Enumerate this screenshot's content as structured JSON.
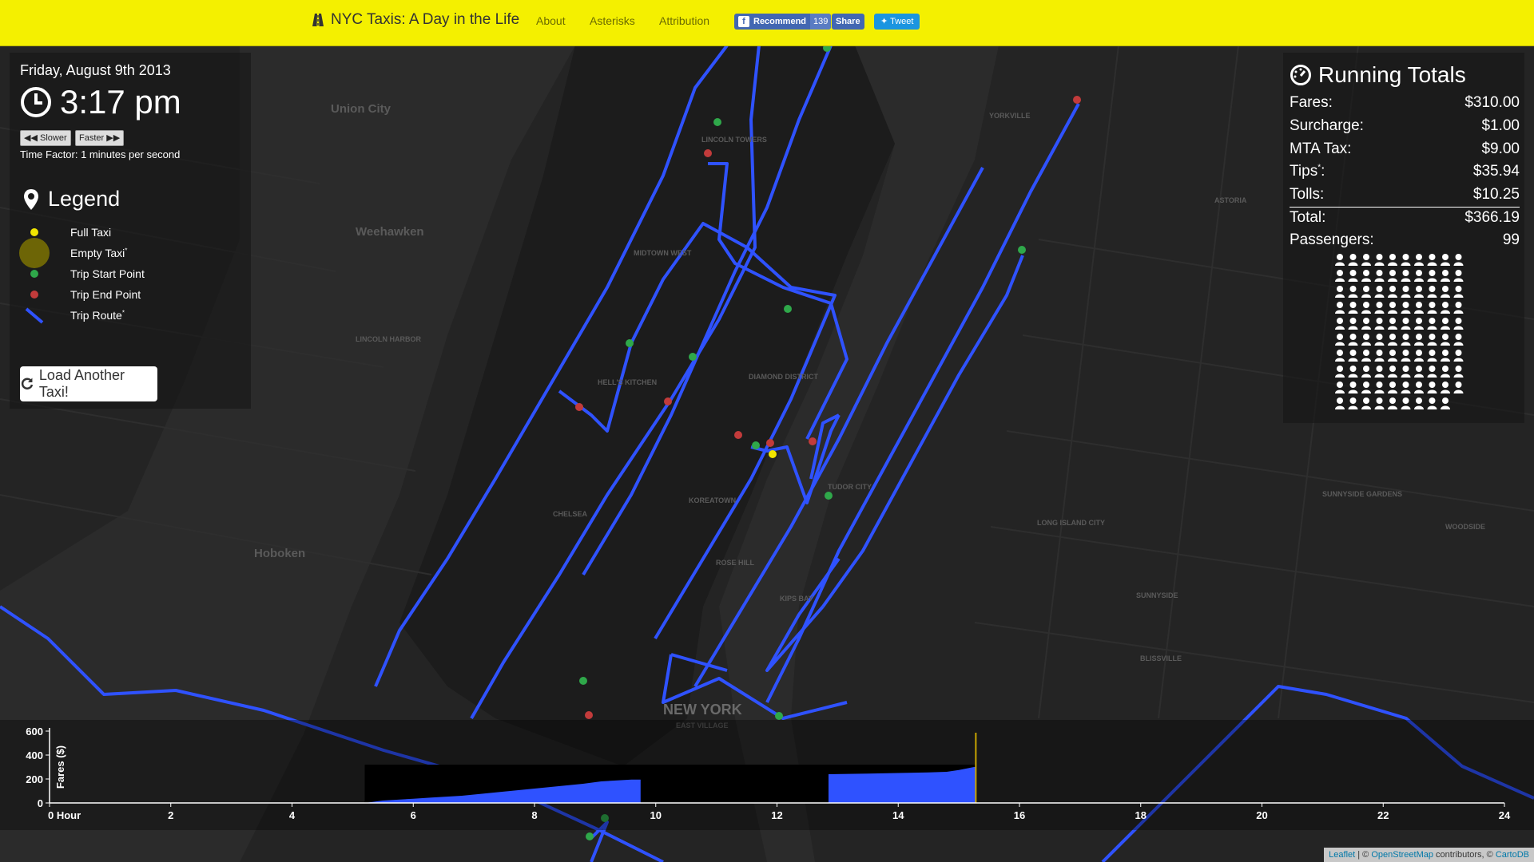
{
  "navbar": {
    "brand": "NYC Taxis: A Day in the Life",
    "links": [
      "About",
      "Asterisks",
      "Attribution"
    ],
    "fb_recommend": "Recommend",
    "fb_count": "139",
    "fb_share": "Share",
    "tweet": "Tweet"
  },
  "status": {
    "date": "Friday, August 9th 2013",
    "time": "3:17 pm",
    "slower": "Slower",
    "faster": "Faster",
    "time_factor": "Time Factor: 1 minutes per second"
  },
  "legend": {
    "title": "Legend",
    "items": [
      {
        "label": "Full Taxi",
        "color": "#f2e600"
      },
      {
        "label": "Empty Taxi",
        "color": "#8a7f00",
        "sup": "*"
      },
      {
        "label": "Trip Start Point",
        "color": "#2fa84a"
      },
      {
        "label": "Trip End Point",
        "color": "#c23b3b"
      },
      {
        "label": "Trip Route",
        "color": "#2f52ff",
        "sup": "*"
      }
    ]
  },
  "load_button": "Load Another Taxi!",
  "totals": {
    "title": "Running Totals",
    "fares_label": "Fares:",
    "fares": "$310.00",
    "surcharge_label": "Surcharge:",
    "surcharge": "$1.00",
    "mta_label": "MTA Tax:",
    "mta": "$9.00",
    "tips_label": "Tips",
    "tips_sup": "*",
    "tips_colon": ":",
    "tips": "$35.94",
    "tolls_label": "Tolls:",
    "tolls": "$10.25",
    "total_label": "Total:",
    "total": "$366.19",
    "passengers_label": "Passengers:",
    "passengers": "99"
  },
  "map_labels": [
    {
      "text": "Union City"
    },
    {
      "text": "Weehawken"
    },
    {
      "text": "Hoboken"
    },
    {
      "text": "NEW YORK"
    },
    {
      "text": "HELL'S KITCHEN"
    },
    {
      "text": "MIDTOWN WEST"
    },
    {
      "text": "DIAMOND DISTRICT"
    },
    {
      "text": "KOREATOWN"
    },
    {
      "text": "CHELSEA"
    },
    {
      "text": "ROSE HILL"
    },
    {
      "text": "KIPS BAY"
    },
    {
      "text": "TUDOR CITY"
    },
    {
      "text": "YORKVILLE"
    },
    {
      "text": "ASTORIA"
    },
    {
      "text": "LONG ISLAND CITY"
    },
    {
      "text": "SUNNYSIDE"
    },
    {
      "text": "WOODSIDE"
    },
    {
      "text": "BLISSVILLE"
    },
    {
      "text": "SUNNYSIDE GARDENS"
    },
    {
      "text": "LINCOLN HARBOR"
    },
    {
      "text": "LINCOLN TOWERS"
    },
    {
      "text": "EAST VILLAGE"
    }
  ],
  "chart_data": {
    "type": "area",
    "ylabel": "Fares ($)",
    "xlabel": "",
    "x_tick_labels": [
      "0 Hour",
      "2",
      "4",
      "6",
      "8",
      "10",
      "12",
      "14",
      "16",
      "18",
      "20",
      "22",
      "24"
    ],
    "y_ticks": [
      0,
      200,
      400,
      600
    ],
    "xlim": [
      0,
      24
    ],
    "ylim": [
      0,
      600
    ],
    "color": "#2f52ff",
    "current_hour": 15.28,
    "series": [
      {
        "values": [
          [
            5.2,
            0
          ],
          [
            5.5,
            20
          ],
          [
            6.0,
            35
          ],
          [
            6.3,
            45
          ],
          [
            6.8,
            60
          ],
          [
            7.2,
            80
          ],
          [
            7.6,
            100
          ],
          [
            8.0,
            120
          ],
          [
            8.4,
            140
          ],
          [
            8.8,
            160
          ],
          [
            9.1,
            180
          ],
          [
            9.6,
            195
          ],
          [
            9.75,
            195
          ],
          [
            9.75,
            0
          ]
        ]
      },
      {
        "values": [
          [
            12.85,
            0
          ],
          [
            12.85,
            240
          ],
          [
            13.5,
            245
          ],
          [
            14.0,
            250
          ],
          [
            14.5,
            255
          ],
          [
            14.8,
            260
          ],
          [
            15.0,
            275
          ],
          [
            15.25,
            300
          ],
          [
            15.28,
            300
          ],
          [
            15.28,
            0
          ]
        ]
      }
    ]
  },
  "attribution": {
    "leaflet": "Leaflet",
    "sep": " | © ",
    "osm": "OpenStreetMap",
    "contrib": " contributors, © ",
    "carto": "CartoDB"
  }
}
